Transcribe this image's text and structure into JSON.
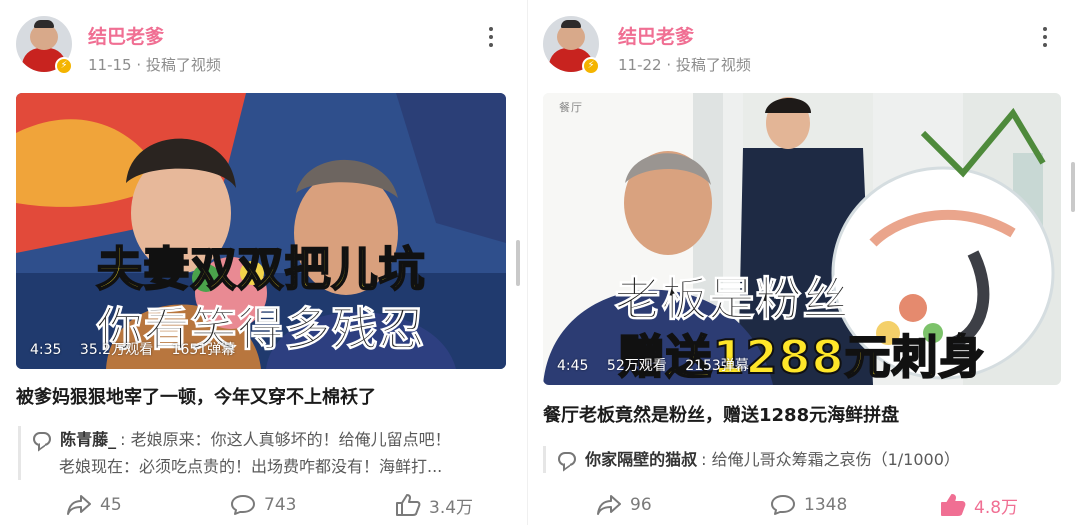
{
  "cards": [
    {
      "username": "结巴老爹",
      "date": "11-15",
      "action_text": "· 投稿了视频",
      "thumbnail": {
        "caption_line1": "夫妻双双把儿坑",
        "caption_line2": "你看笑得多残忍",
        "duration": "4:35",
        "views": "35.2万观看",
        "danmaku": "1651弹幕"
      },
      "title": "被爹妈狠狠地宰了一顿，今年又穿不上棉袄了",
      "comments": [
        {
          "user": "陈青藤_",
          "text": "老娘原来：你这人真够坏的！给俺儿留点吧！"
        },
        {
          "user": "",
          "text": "老娘现在：必须吃点贵的！出场费咋都没有！海鲜打..."
        }
      ],
      "shares": "45",
      "comment_count": "743",
      "likes": "3.4万",
      "liked": false
    },
    {
      "username": "结巴老爹",
      "date": "11-22",
      "action_text": "· 投稿了视频",
      "thumbnail": {
        "caption_line1": "老板是粉丝",
        "caption_line2": "赠送1288元刺身",
        "duration": "4:45",
        "views": "52万观看",
        "danmaku": "2153弹幕",
        "sign_text": "餐厅"
      },
      "title": "餐厅老板竟然是粉丝，赠送1288元海鲜拼盘",
      "comments": [
        {
          "user": "你家隔壁的猫叔",
          "text": "给俺儿哥众筹霜之哀伤（1/1000）"
        }
      ],
      "shares": "96",
      "comment_count": "1348",
      "likes": "4.8万",
      "liked": true
    }
  ],
  "colors": {
    "username": "#f06f93",
    "liked": "#f06f93",
    "caption_yellow": "#ffe629",
    "meta": "#8d8d8d"
  },
  "icons": [
    "share-icon",
    "comment-icon",
    "like-icon",
    "more-icon",
    "verified-badge-icon",
    "comment-bubble-icon"
  ]
}
